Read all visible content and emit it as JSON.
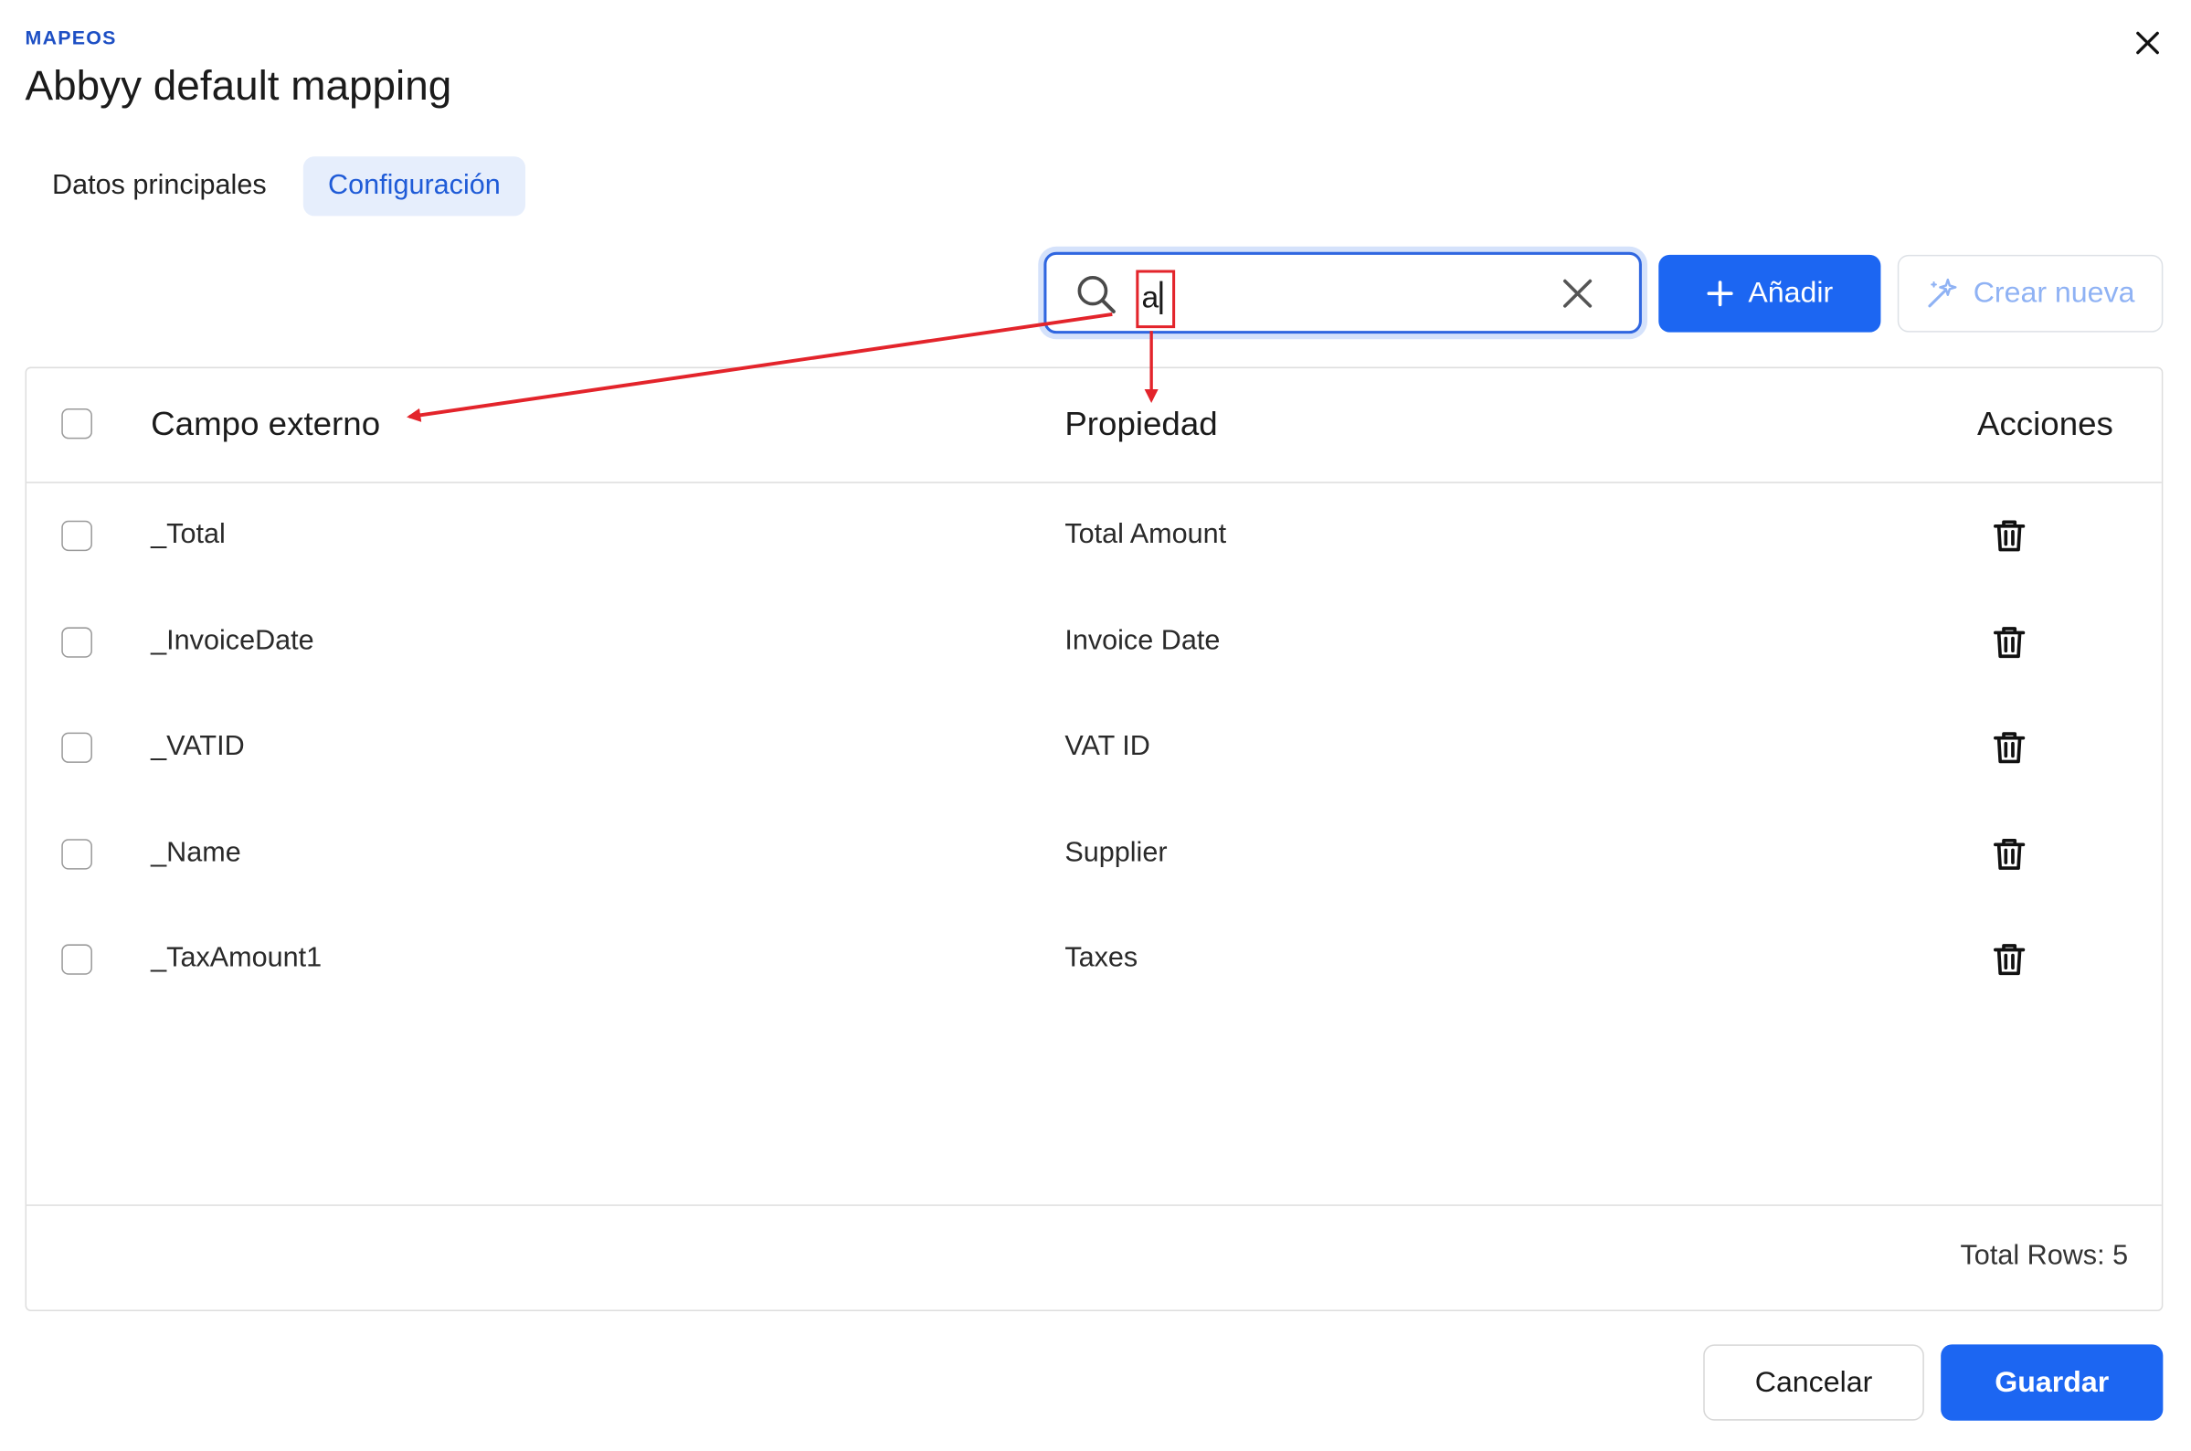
{
  "header": {
    "section_label": "MAPEOS",
    "title": "Abbyy default mapping"
  },
  "tabs": [
    {
      "label": "Datos principales",
      "active": false
    },
    {
      "label": "Configuración",
      "active": true
    }
  ],
  "toolbar": {
    "search_value": "a",
    "add_label": "Añadir",
    "create_label": "Crear nueva"
  },
  "table": {
    "columns": [
      "Campo externo",
      "Propiedad",
      "Acciones"
    ],
    "rows": [
      {
        "external_field": "_Total",
        "property": "Total Amount"
      },
      {
        "external_field": "_InvoiceDate",
        "property": "Invoice Date"
      },
      {
        "external_field": "_VATID",
        "property": "VAT ID"
      },
      {
        "external_field": "_Name",
        "property": "Supplier"
      },
      {
        "external_field": "_TaxAmount1",
        "property": "Taxes"
      }
    ],
    "total_rows_label": "Total Rows: 5"
  },
  "footer": {
    "cancel_label": "Cancelar",
    "save_label": "Guardar"
  },
  "colors": {
    "accent": "#1c66f2",
    "active_tab_bg": "#e6eefc",
    "section_label": "#1d4fc4",
    "annotation": "#e3242b"
  },
  "icons": {
    "close": "close-icon",
    "search": "search-icon",
    "clear": "clear-icon",
    "add": "plus-icon",
    "create": "magic-wand-icon",
    "delete": "trash-icon"
  }
}
